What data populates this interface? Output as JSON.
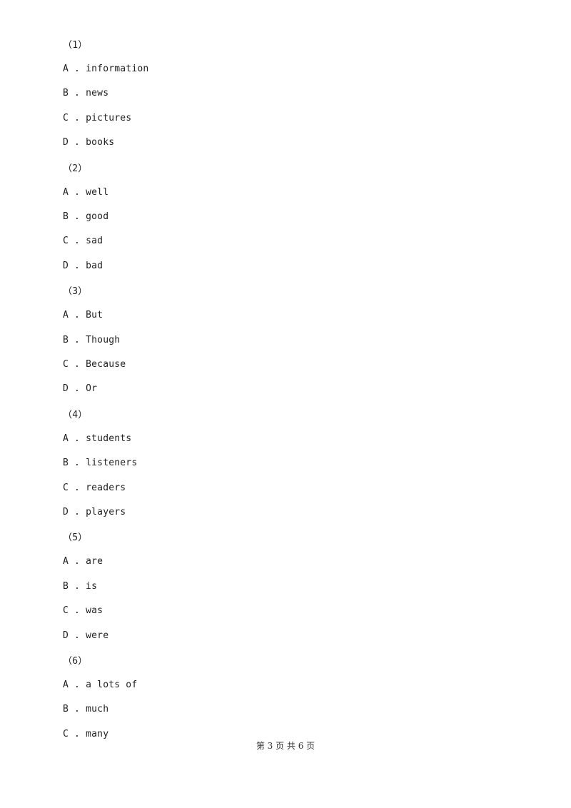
{
  "questions": [
    {
      "number": "（1）",
      "options": [
        {
          "letter": "A",
          "text": "information"
        },
        {
          "letter": "B",
          "text": "news"
        },
        {
          "letter": "C",
          "text": "pictures"
        },
        {
          "letter": "D",
          "text": "books"
        }
      ]
    },
    {
      "number": "（2）",
      "options": [
        {
          "letter": "A",
          "text": "well"
        },
        {
          "letter": "B",
          "text": "good"
        },
        {
          "letter": "C",
          "text": "sad"
        },
        {
          "letter": "D",
          "text": "bad"
        }
      ]
    },
    {
      "number": "（3）",
      "options": [
        {
          "letter": "A",
          "text": "But"
        },
        {
          "letter": "B",
          "text": "Though"
        },
        {
          "letter": "C",
          "text": "Because"
        },
        {
          "letter": "D",
          "text": "Or"
        }
      ]
    },
    {
      "number": "（4）",
      "options": [
        {
          "letter": "A",
          "text": "students"
        },
        {
          "letter": "B",
          "text": "listeners"
        },
        {
          "letter": "C",
          "text": "readers"
        },
        {
          "letter": "D",
          "text": "players"
        }
      ]
    },
    {
      "number": "（5）",
      "options": [
        {
          "letter": "A",
          "text": "are"
        },
        {
          "letter": "B",
          "text": "is"
        },
        {
          "letter": "C",
          "text": "was"
        },
        {
          "letter": "D",
          "text": "were"
        }
      ]
    },
    {
      "number": "（6）",
      "options": [
        {
          "letter": "A",
          "text": "a lots of"
        },
        {
          "letter": "B",
          "text": "much"
        },
        {
          "letter": "C",
          "text": "many"
        }
      ]
    }
  ],
  "footer": {
    "text": "第 3 页 共 6 页"
  }
}
